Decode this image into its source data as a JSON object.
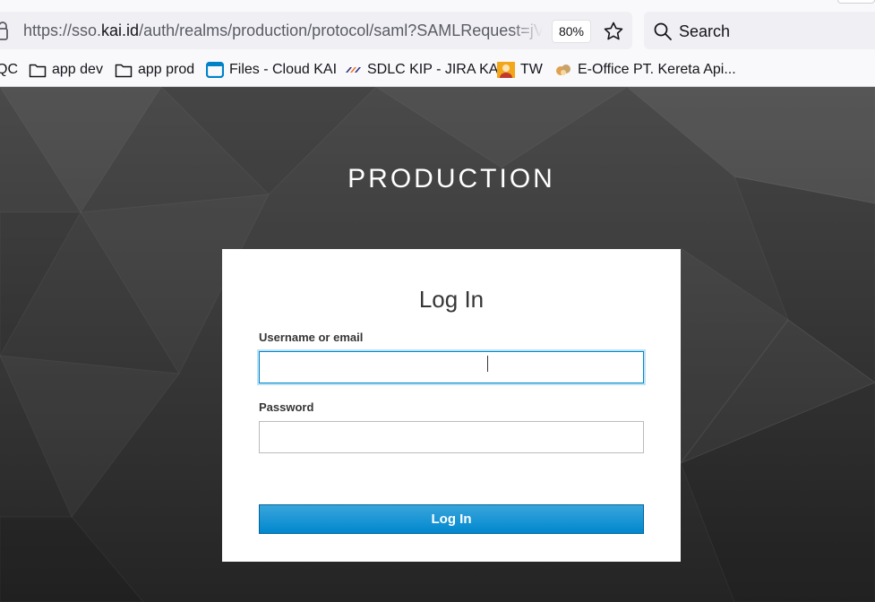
{
  "browser": {
    "url": {
      "prefix": "https://sso.",
      "domain": "kai.id",
      "path": "/auth/realms/production/protocol/saml?SAMLRequest=jV"
    },
    "zoom_level": "80%",
    "search_label": "Search",
    "bookmarks": [
      {
        "label": "QC",
        "icon": "folder-icon"
      },
      {
        "label": "app dev",
        "icon": "folder-icon"
      },
      {
        "label": "app prod",
        "icon": "folder-icon"
      },
      {
        "label": "Files - Cloud KAI",
        "icon": "cloud-files-icon"
      },
      {
        "label": "SDLC KIP - JIRA KAI",
        "icon": "kai-logo-icon"
      },
      {
        "label": "TW",
        "icon": "avatar-icon"
      },
      {
        "label": "E-Office PT. Kereta Api...",
        "icon": "eoffice-icon"
      }
    ]
  },
  "page": {
    "realm_title": "PRODUCTION",
    "login": {
      "heading": "Log In",
      "username_label": "Username or email",
      "username_value": "",
      "password_label": "Password",
      "password_value": "",
      "submit_label": "Log In"
    }
  },
  "colors": {
    "accent": "#0088ce",
    "background_dark": "#2b2b2b",
    "card": "#ffffff",
    "text": "#363636"
  }
}
